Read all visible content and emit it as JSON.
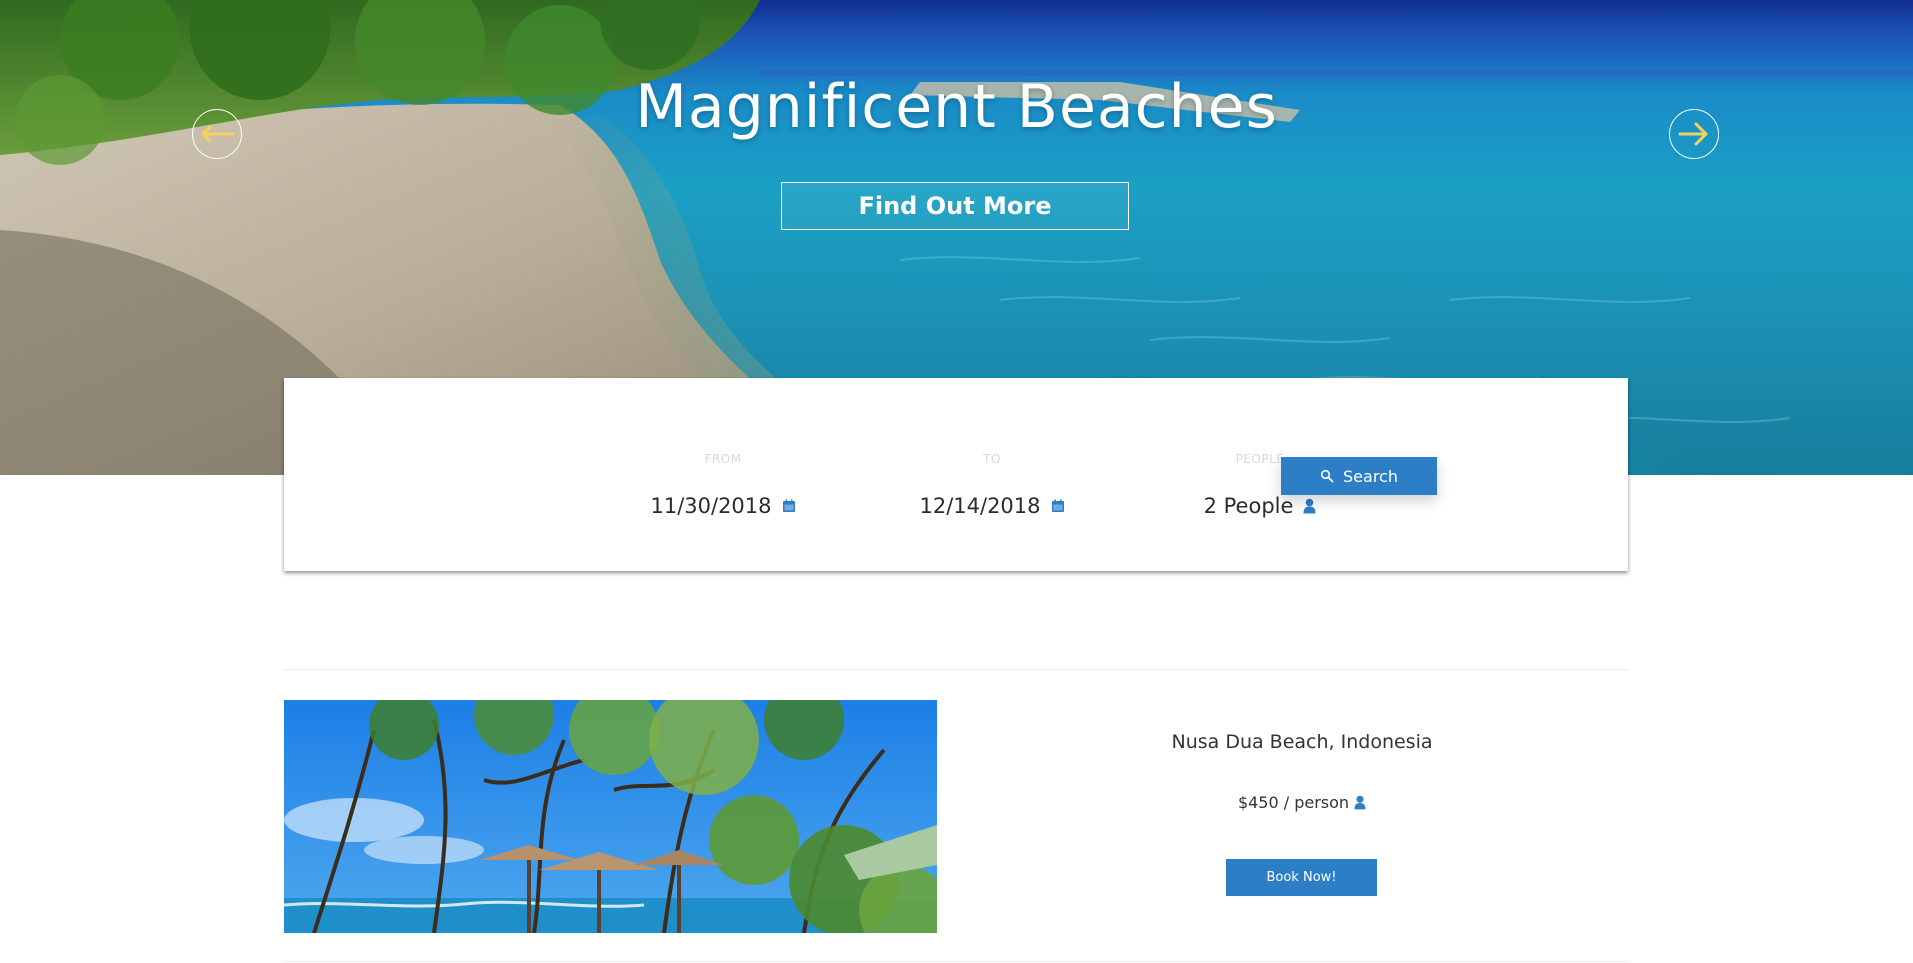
{
  "hero": {
    "title": "Magnificent Beaches",
    "cta_label": "Find Out More",
    "prev_icon": "arrow-left-icon",
    "next_icon": "arrow-right-icon",
    "arrow_color": "#f2d45c"
  },
  "search": {
    "from_label": "FROM",
    "from_value": "11/30/2018",
    "to_label": "TO",
    "to_value": "12/14/2018",
    "people_label": "PEOPLE",
    "people_value": "2 People",
    "button_label": "Search",
    "calendar_icon": "calendar-icon",
    "person_icon": "person-icon",
    "search_icon": "search-icon"
  },
  "listing": {
    "title": "Nusa Dua Beach, Indonesia",
    "price": "$450 / person",
    "book_label": "Book Now!"
  },
  "colors": {
    "accent": "#2c7ec7",
    "arrow_accent": "#f2d45c"
  }
}
